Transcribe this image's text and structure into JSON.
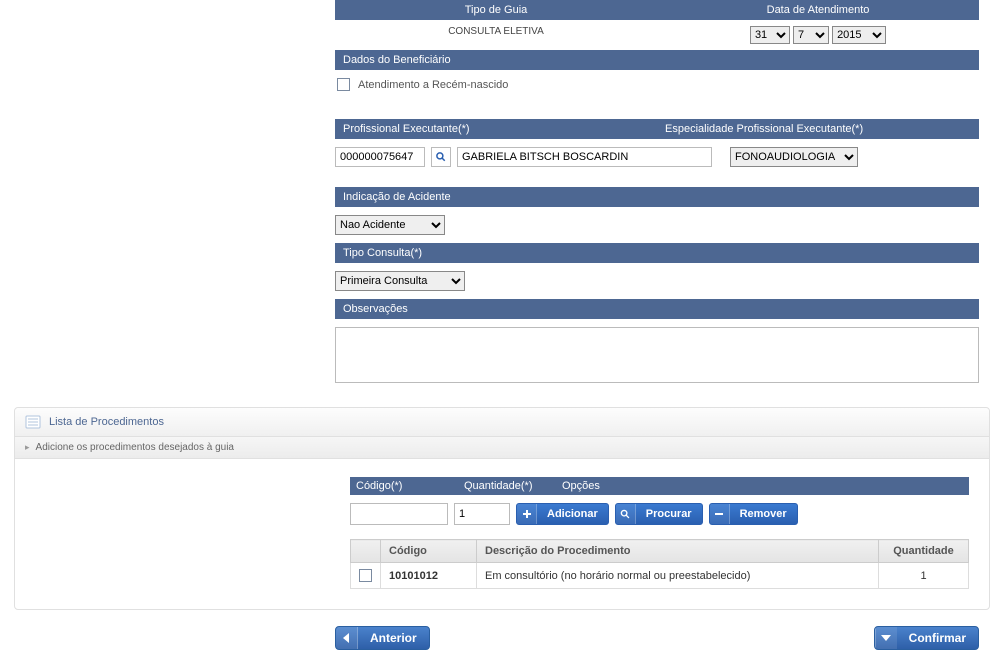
{
  "headers": {
    "tipo_guia": "Tipo de Guia",
    "data_atendimento": "Data de Atendimento",
    "dados_beneficiario": "Dados do Beneficiário",
    "profissional_exec": "Profissional Executante(*)",
    "especialidade_exec": "Especialidade Profissional Executante(*)",
    "indicacao_acidente": "Indicação de Acidente",
    "tipo_consulta": "Tipo Consulta(*)",
    "observacoes": "Observações",
    "lista_proc": "Lista de Procedimentos",
    "adicione_proc": "Adicione os procedimentos desejados à guia",
    "codigo": "Código(*)",
    "quantidade_label": "Quantidade(*)",
    "opcoes": "Opções"
  },
  "values": {
    "tipo_guia_value": "CONSULTA ELETIVA",
    "date_day": "31",
    "date_month": "7",
    "date_year": "2015",
    "recem_nascido_label": "Atendimento a Recém-nascido",
    "prof_code": "000000075647",
    "prof_name": "GABRIELA BITSCH BOSCARDIN",
    "especialidade": "FONOAUDIOLOGIA",
    "acidente": "Nao Acidente",
    "tipo_consulta_value": "Primeira Consulta",
    "observacoes_value": "",
    "proc_code_input": "",
    "proc_qty_input": "1"
  },
  "buttons": {
    "adicionar": "Adicionar",
    "procurar": "Procurar",
    "remover": "Remover",
    "anterior": "Anterior",
    "confirmar": "Confirmar"
  },
  "table": {
    "col_codigo": "Código",
    "col_descricao": "Descrição do Procedimento",
    "col_quantidade": "Quantidade",
    "rows": [
      {
        "codigo": "10101012",
        "descricao": "Em consultório (no horário normal ou preestabelecido)",
        "quantidade": "1"
      }
    ]
  }
}
